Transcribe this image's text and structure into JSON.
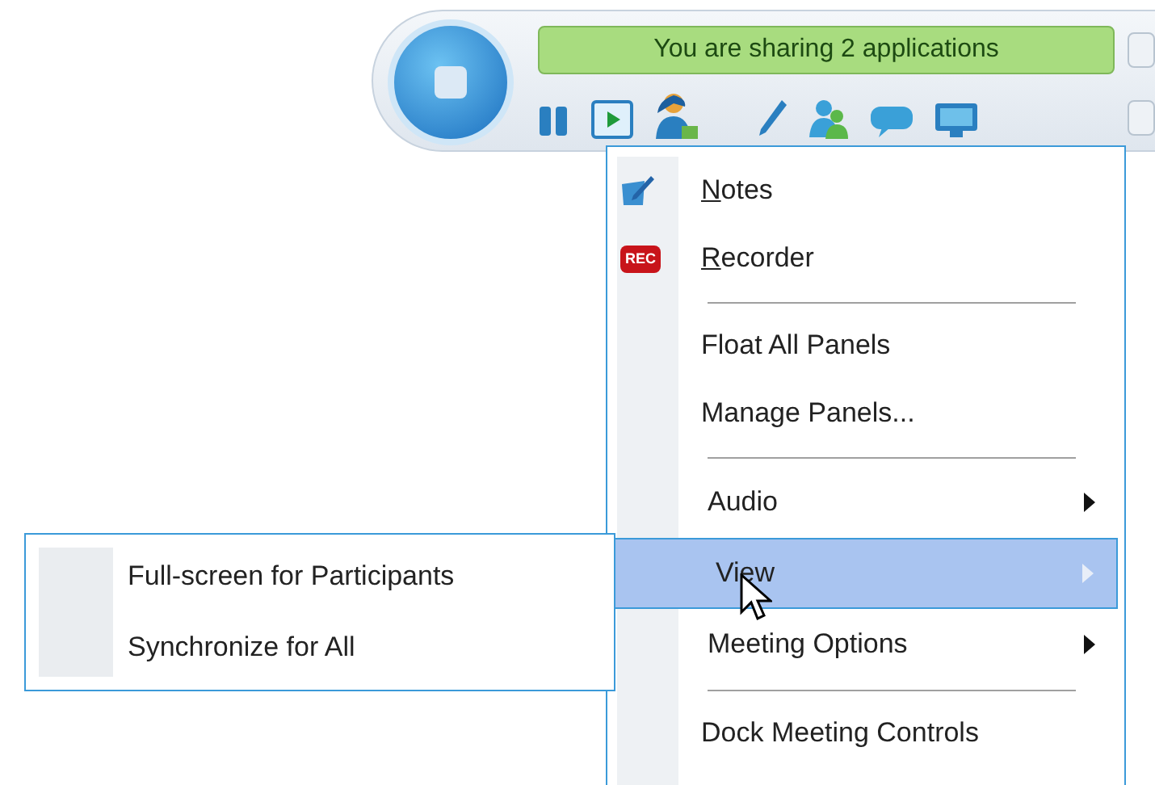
{
  "toolbar": {
    "banner": "You are sharing 2 applications",
    "tools": [
      {
        "kind": "pause"
      },
      {
        "kind": "play",
        "selected": true
      },
      {
        "kind": "person"
      },
      {
        "kind": "pen"
      },
      {
        "kind": "people"
      },
      {
        "kind": "chat"
      },
      {
        "kind": "screen"
      }
    ]
  },
  "menu": {
    "items": [
      {
        "kind": "notes",
        "label": "Notes",
        "underline_first": true
      },
      {
        "kind": "recorder",
        "icon_text": "REC",
        "label": "Recorder",
        "underline_first": true
      },
      {
        "kind": "separator"
      },
      {
        "kind": "item",
        "label": "Float All Panels",
        "underline_first": false
      },
      {
        "kind": "item",
        "label": "Manage Panels...",
        "underline_first": false
      },
      {
        "kind": "separator"
      },
      {
        "kind": "submenu",
        "label": "Audio",
        "selected": false
      },
      {
        "kind": "submenu",
        "label": "View",
        "selected": true
      },
      {
        "kind": "submenu",
        "label": "Meeting Options",
        "selected": false
      },
      {
        "kind": "separator"
      },
      {
        "kind": "item",
        "label": "Dock Meeting Controls",
        "underline_first": false
      }
    ]
  },
  "submenu": {
    "items": [
      {
        "label": "Full-screen for Participants"
      },
      {
        "label": "Synchronize for All"
      }
    ]
  }
}
